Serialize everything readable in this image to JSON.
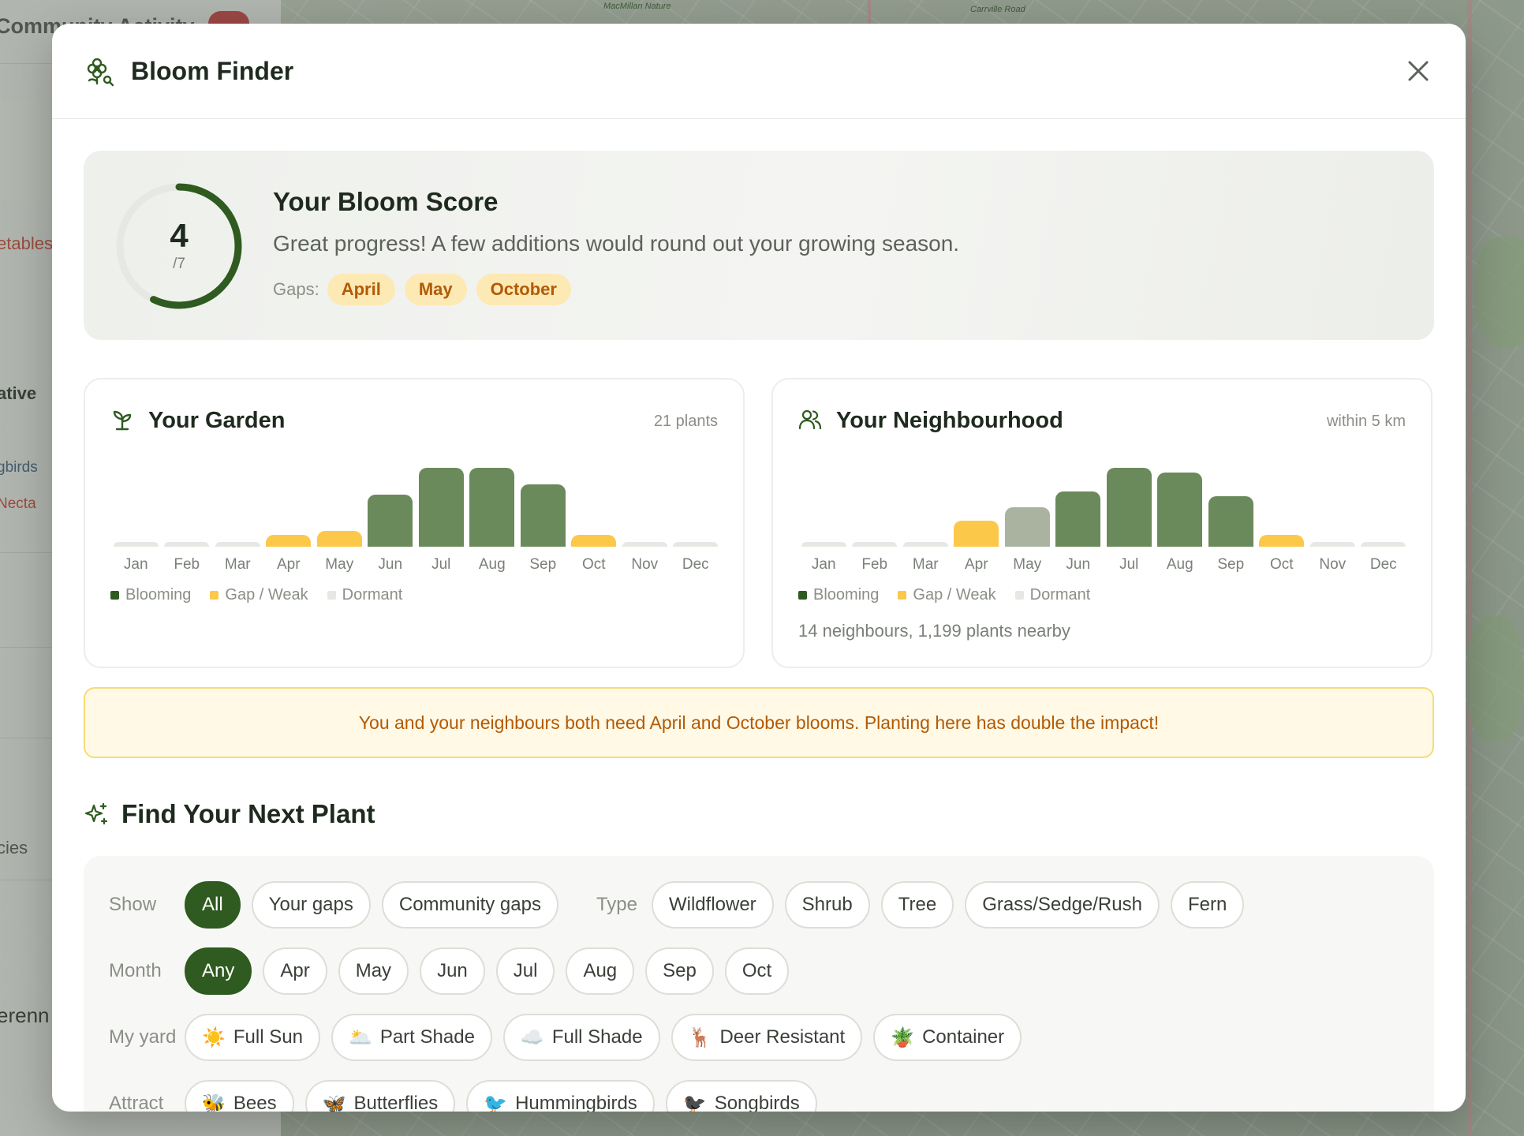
{
  "background": {
    "panel_title": "Community Activity",
    "panel_items": [
      "etables",
      "ative",
      "gbirds",
      "Necta",
      "cies",
      "erenn"
    ],
    "map_labels": [
      "MacMillan Nature",
      "Carrville Road"
    ]
  },
  "modal": {
    "title": "Bloom Finder",
    "close_label": "×"
  },
  "score": {
    "value": "4",
    "denominator": "/7",
    "value_fraction": 0.571,
    "heading": "Your Bloom Score",
    "message": "Great progress! A few additions would round out your growing season.",
    "gaps_label": "Gaps:",
    "gaps": [
      "April",
      "May",
      "October"
    ]
  },
  "garden": {
    "title": "Your Garden",
    "meta": "21 plants",
    "months": [
      "Jan",
      "Feb",
      "Mar",
      "Apr",
      "May",
      "Jun",
      "Jul",
      "Aug",
      "Sep",
      "Oct",
      "Nov",
      "Dec"
    ],
    "bars": [
      {
        "level": 0.06,
        "status": "dormant"
      },
      {
        "level": 0.06,
        "status": "dormant"
      },
      {
        "level": 0.06,
        "status": "dormant"
      },
      {
        "level": 0.15,
        "status": "gap"
      },
      {
        "level": 0.2,
        "status": "gap"
      },
      {
        "level": 0.66,
        "status": "blooming"
      },
      {
        "level": 1.0,
        "status": "blooming"
      },
      {
        "level": 1.0,
        "status": "blooming"
      },
      {
        "level": 0.79,
        "status": "blooming"
      },
      {
        "level": 0.15,
        "status": "gap"
      },
      {
        "level": 0.06,
        "status": "dormant"
      },
      {
        "level": 0.06,
        "status": "dormant"
      }
    ],
    "legend": {
      "blooming": "Blooming",
      "gap": "Gap / Weak",
      "dormant": "Dormant"
    }
  },
  "neighbourhood": {
    "title": "Your Neighbourhood",
    "meta": "within 5 km",
    "months": [
      "Jan",
      "Feb",
      "Mar",
      "Apr",
      "May",
      "Jun",
      "Jul",
      "Aug",
      "Sep",
      "Oct",
      "Nov",
      "Dec"
    ],
    "bars": [
      {
        "level": 0.06,
        "status": "dormant"
      },
      {
        "level": 0.06,
        "status": "dormant"
      },
      {
        "level": 0.06,
        "status": "dormant"
      },
      {
        "level": 0.33,
        "status": "gap"
      },
      {
        "level": 0.5,
        "status": "weak"
      },
      {
        "level": 0.7,
        "status": "blooming"
      },
      {
        "level": 1.0,
        "status": "blooming"
      },
      {
        "level": 0.94,
        "status": "blooming"
      },
      {
        "level": 0.64,
        "status": "blooming"
      },
      {
        "level": 0.15,
        "status": "gap"
      },
      {
        "level": 0.06,
        "status": "dormant"
      },
      {
        "level": 0.06,
        "status": "dormant"
      }
    ],
    "legend": {
      "blooming": "Blooming",
      "gap": "Gap / Weak",
      "dormant": "Dormant"
    },
    "footer": "14 neighbours, 1,199 plants nearby"
  },
  "banner": "You and your neighbours both need April and October blooms. Planting here has double the impact!",
  "find": {
    "title": "Find Your Next Plant",
    "show_label": "Show",
    "show_options": [
      "All",
      "Your gaps",
      "Community gaps"
    ],
    "show_selected": "All",
    "type_label": "Type",
    "type_options": [
      "Wildflower",
      "Shrub",
      "Tree",
      "Grass/Sedge/Rush",
      "Fern"
    ],
    "month_label": "Month",
    "month_options": [
      "Any",
      "Apr",
      "May",
      "Jun",
      "Jul",
      "Aug",
      "Sep",
      "Oct"
    ],
    "month_selected": "Any",
    "yard_label": "My yard",
    "yard_options": [
      {
        "icon": "☀️",
        "label": "Full Sun"
      },
      {
        "icon": "🌥️",
        "label": "Part Shade"
      },
      {
        "icon": "☁️",
        "label": "Full Shade"
      },
      {
        "icon": "🦌",
        "label": "Deer Resistant"
      },
      {
        "icon": "🪴",
        "label": "Container"
      }
    ],
    "attract_label": "Attract",
    "attract_options": [
      {
        "icon": "🐝",
        "label": "Bees"
      },
      {
        "icon": "🦋",
        "label": "Butterflies"
      },
      {
        "icon": "🐦",
        "label": "Hummingbirds"
      },
      {
        "icon": "🐦‍⬛",
        "label": "Songbirds"
      }
    ]
  },
  "colors": {
    "blooming": "#6b8a5b",
    "gap": "#fcc84a",
    "weak": "#a9b3a0",
    "dormant": "#e6e8e4",
    "accent": "#2f5a20",
    "ring_track": "#e6e8e4"
  }
}
